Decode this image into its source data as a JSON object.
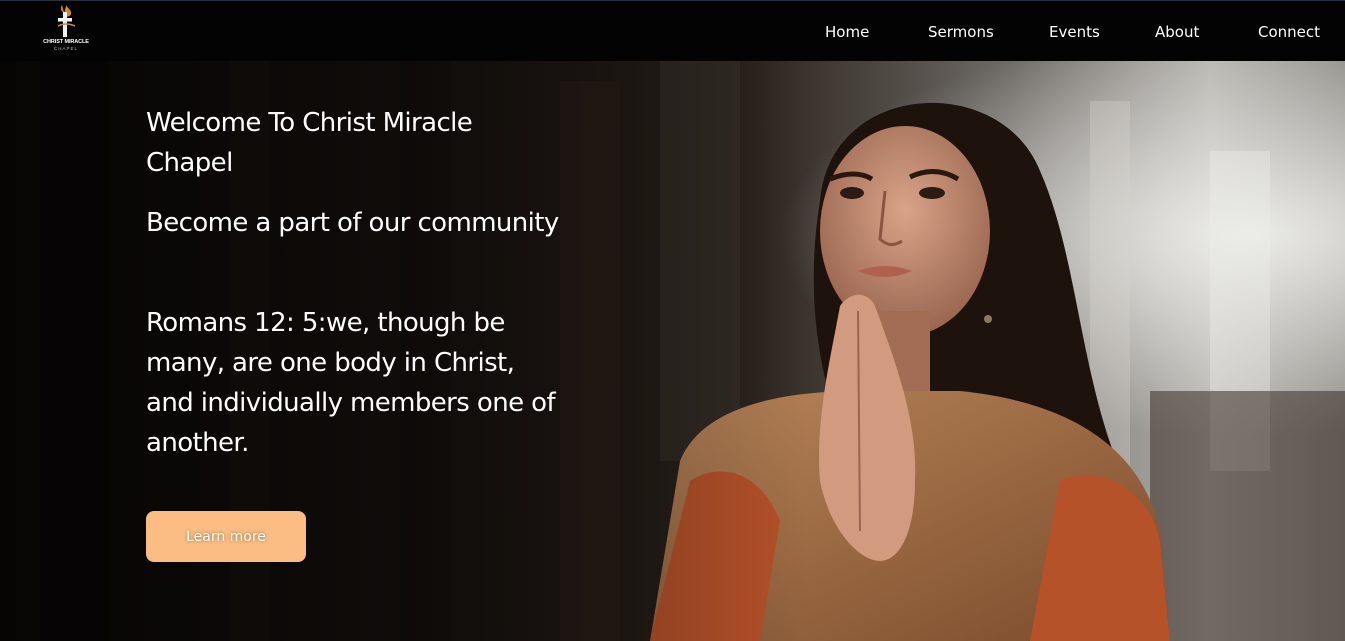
{
  "header": {
    "logo": {
      "line1": "CHRIST MIRACLE",
      "line2": "CHAPEL",
      "icon": "cross-dove-icon"
    },
    "nav": [
      {
        "label": "Home"
      },
      {
        "label": "Sermons"
      },
      {
        "label": "Events"
      },
      {
        "label": "About"
      },
      {
        "label": "Connect"
      }
    ]
  },
  "hero": {
    "title": "Welcome To Christ Miracle Chapel",
    "subtitle": "Become a part of our community",
    "verse": "Romans 12: 5:we, though be many, are one body in Christ, and individually members one of another.",
    "button_label": "Learn more",
    "image": "woman-praying-in-church-photo"
  },
  "colors": {
    "navbar_bg": "#030303",
    "button_bg": "#fbbd83",
    "text": "#ffffff"
  }
}
